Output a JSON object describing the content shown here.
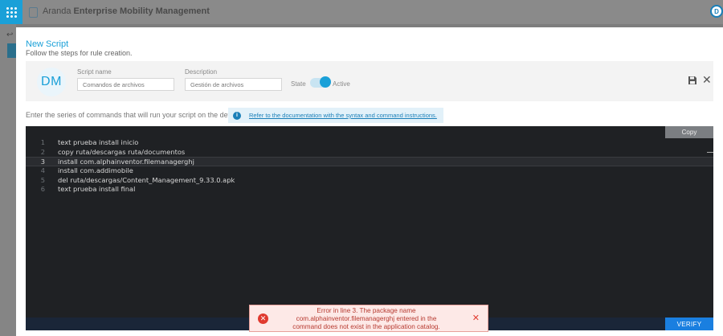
{
  "app": {
    "brand": "Aranda",
    "product": "Enterprise Mobility Management"
  },
  "modal": {
    "title": "New Script",
    "subtitle": "Follow the steps for rule creation.",
    "avatar_text": "DM",
    "script_name_label": "Script name",
    "script_name_value": "Comandos de archivos",
    "description_label": "Description",
    "description_value": "Gestión de archivos",
    "state_label": "State",
    "state_value": "Active",
    "state_on": true,
    "instructions": "Enter the series of commands that will run your script on the device",
    "doc_link": "Refer to the documentation with the syntax and command instructions."
  },
  "editor": {
    "copy_label": "Copy",
    "verify_label": "VERIFY",
    "current_line": 3,
    "lines": [
      {
        "n": "1",
        "text": "text prueba install inicio"
      },
      {
        "n": "2",
        "text": "copy ruta/descargas ruta/documentos"
      },
      {
        "n": "3",
        "text": "install com.alphainventor.filemanagerghj"
      },
      {
        "n": "4",
        "text": "install com.addimobile"
      },
      {
        "n": "5",
        "text": "del  ruta/descargas/Content_Management_9.33.0.apk"
      },
      {
        "n": "6",
        "text": "text prueba install final"
      }
    ]
  },
  "error": {
    "line1": "Error in line 3. The package name",
    "line2": "com.alphainventor.filemanagerghj entered in the",
    "line3": "command does not exist in the application catalog."
  },
  "colors": {
    "accent": "#1aa0d8",
    "error": "#e03a2f",
    "editor_bg": "#1f2124",
    "verify": "#1a7fe0"
  }
}
